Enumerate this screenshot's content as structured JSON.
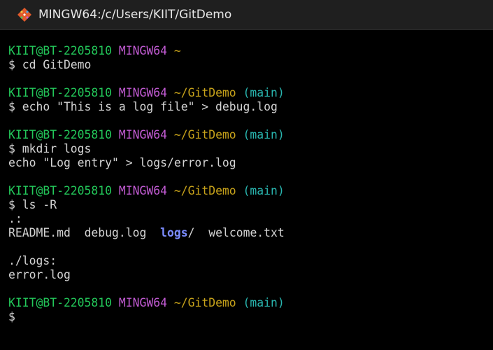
{
  "window": {
    "title": "MINGW64:/c/Users/KIIT/GitDemo"
  },
  "icons": {
    "app": "git-diamond-icon"
  },
  "colors": {
    "user": "#23c85a",
    "env": "#c25bd3",
    "path": "#c7a21a",
    "branch": "#29b6b0",
    "text": "#d3d3d3",
    "directory": "#7b8cff",
    "background": "#000000",
    "titlebar": "#1f1f1f"
  },
  "terminal": {
    "blocks": [
      {
        "prompt": {
          "user": "KIIT@BT-2205810",
          "env": "MINGW64",
          "path": "~",
          "branch": ""
        },
        "command": "$ cd GitDemo",
        "output": []
      },
      {
        "prompt": {
          "user": "KIIT@BT-2205810",
          "env": "MINGW64",
          "path": "~/GitDemo",
          "branch": "(main)"
        },
        "command": "$ echo \"This is a log file\" > debug.log",
        "output": []
      },
      {
        "prompt": {
          "user": "KIIT@BT-2205810",
          "env": "MINGW64",
          "path": "~/GitDemo",
          "branch": "(main)"
        },
        "command": "$ mkdir logs",
        "output": [
          "echo \"Log entry\" > logs/error.log"
        ]
      },
      {
        "prompt": {
          "user": "KIIT@BT-2205810",
          "env": "MINGW64",
          "path": "~/GitDemo",
          "branch": "(main)"
        },
        "command": "$ ls -R",
        "output": [
          ".:"
        ],
        "listing": {
          "file1": "README.md",
          "file2": "debug.log",
          "dir": "logs",
          "dir_suffix": "/",
          "file3": "welcome.txt"
        },
        "after": [
          "",
          "./logs:",
          "error.log"
        ]
      },
      {
        "prompt": {
          "user": "KIIT@BT-2205810",
          "env": "MINGW64",
          "path": "~/GitDemo",
          "branch": "(main)"
        },
        "command": "$",
        "output": []
      }
    ]
  }
}
